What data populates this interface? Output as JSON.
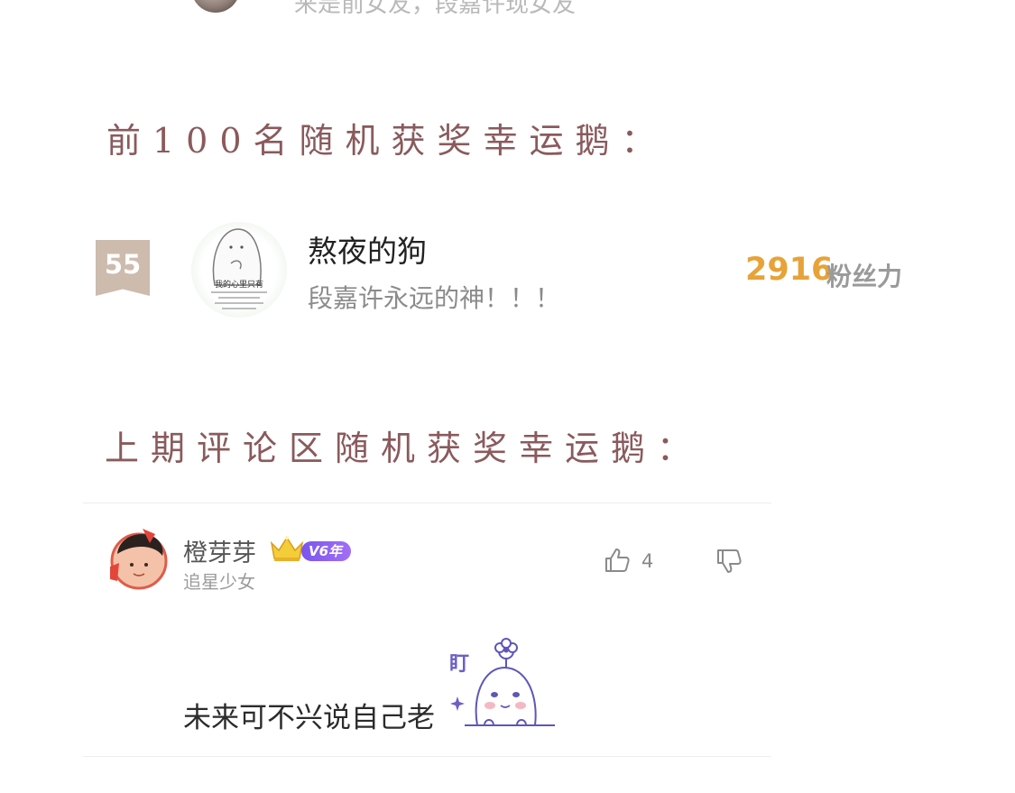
{
  "top_row": {
    "text": "来是前女友，段嘉许现女友"
  },
  "section_top100": {
    "heading": "前100名随机获奖幸运鹅："
  },
  "fan": {
    "rank": "55",
    "name": "熬夜的狗",
    "motto": "段嘉许永远的神！！！",
    "score": "2916",
    "score_label": "粉丝力",
    "avatar_caption": "我的心里只有"
  },
  "section_comment": {
    "heading": "上期评论区随机获奖幸运鹅："
  },
  "comment": {
    "user_name": "橙芽芽",
    "vip_label": "V6年",
    "user_tag": "追星少女",
    "like_count": "4",
    "text": "未来可不兴说自己老",
    "sticker_label": "盯"
  },
  "colors": {
    "heading": "#8a5a5c",
    "score": "#e7a338",
    "rank_badge": "#cdbbae",
    "vip": "#7a55ee"
  },
  "icons": [
    "thumbs-up-icon",
    "thumbs-down-icon",
    "crown-icon"
  ]
}
